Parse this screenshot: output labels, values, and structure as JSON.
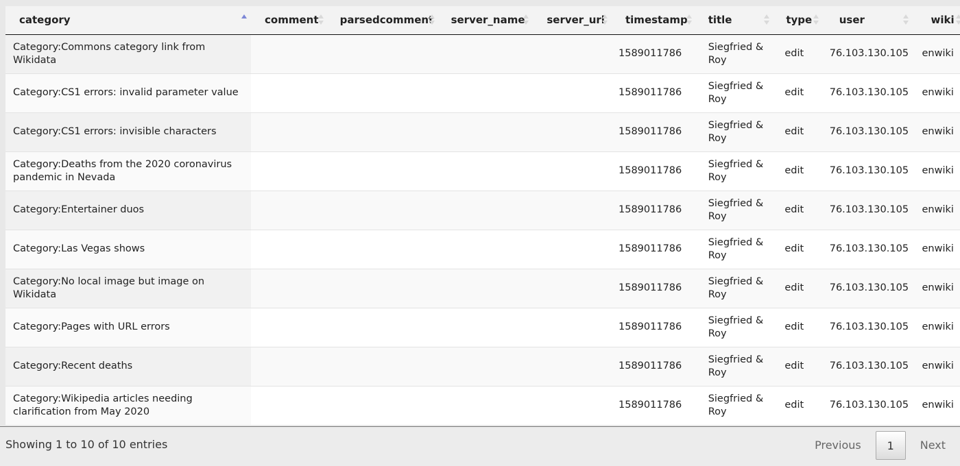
{
  "table": {
    "columns": [
      {
        "key": "category",
        "label": "category",
        "sort": "asc"
      },
      {
        "key": "comment",
        "label": "comment",
        "sort": "none"
      },
      {
        "key": "parsedcomment",
        "label": "parsedcomment",
        "sort": "none"
      },
      {
        "key": "server_name",
        "label": "server_name",
        "sort": "none"
      },
      {
        "key": "server_url",
        "label": "server_url",
        "sort": "none"
      },
      {
        "key": "timestamp",
        "label": "timestamp",
        "sort": "none"
      },
      {
        "key": "title",
        "label": "title",
        "sort": "none"
      },
      {
        "key": "type",
        "label": "type",
        "sort": "none"
      },
      {
        "key": "user",
        "label": "user",
        "sort": "none"
      },
      {
        "key": "wiki",
        "label": "wiki",
        "sort": "none"
      }
    ],
    "rows": [
      {
        "category": "Category:Commons category link from Wikidata",
        "comment": "",
        "parsedcomment": "",
        "server_name": "",
        "server_url": "",
        "timestamp": "1589011786",
        "title": "Siegfried & Roy",
        "type": "edit",
        "user": "76.103.130.105",
        "wiki": "enwiki"
      },
      {
        "category": "Category:CS1 errors: invalid parameter value",
        "comment": "",
        "parsedcomment": "",
        "server_name": "",
        "server_url": "",
        "timestamp": "1589011786",
        "title": "Siegfried & Roy",
        "type": "edit",
        "user": "76.103.130.105",
        "wiki": "enwiki"
      },
      {
        "category": "Category:CS1 errors: invisible characters",
        "comment": "",
        "parsedcomment": "",
        "server_name": "",
        "server_url": "",
        "timestamp": "1589011786",
        "title": "Siegfried & Roy",
        "type": "edit",
        "user": "76.103.130.105",
        "wiki": "enwiki"
      },
      {
        "category": "Category:Deaths from the 2020 coronavirus pandemic in Nevada",
        "comment": "",
        "parsedcomment": "",
        "server_name": "",
        "server_url": "",
        "timestamp": "1589011786",
        "title": "Siegfried & Roy",
        "type": "edit",
        "user": "76.103.130.105",
        "wiki": "enwiki"
      },
      {
        "category": "Category:Entertainer duos",
        "comment": "",
        "parsedcomment": "",
        "server_name": "",
        "server_url": "",
        "timestamp": "1589011786",
        "title": "Siegfried & Roy",
        "type": "edit",
        "user": "76.103.130.105",
        "wiki": "enwiki"
      },
      {
        "category": "Category:Las Vegas shows",
        "comment": "",
        "parsedcomment": "",
        "server_name": "",
        "server_url": "",
        "timestamp": "1589011786",
        "title": "Siegfried & Roy",
        "type": "edit",
        "user": "76.103.130.105",
        "wiki": "enwiki"
      },
      {
        "category": "Category:No local image but image on Wikidata",
        "comment": "",
        "parsedcomment": "",
        "server_name": "",
        "server_url": "",
        "timestamp": "1589011786",
        "title": "Siegfried & Roy",
        "type": "edit",
        "user": "76.103.130.105",
        "wiki": "enwiki"
      },
      {
        "category": "Category:Pages with URL errors",
        "comment": "",
        "parsedcomment": "",
        "server_name": "",
        "server_url": "",
        "timestamp": "1589011786",
        "title": "Siegfried & Roy",
        "type": "edit",
        "user": "76.103.130.105",
        "wiki": "enwiki"
      },
      {
        "category": "Category:Recent deaths",
        "comment": "",
        "parsedcomment": "",
        "server_name": "",
        "server_url": "",
        "timestamp": "1589011786",
        "title": "Siegfried & Roy",
        "type": "edit",
        "user": "76.103.130.105",
        "wiki": "enwiki"
      },
      {
        "category": "Category:Wikipedia articles needing clarification from May 2020",
        "comment": "",
        "parsedcomment": "",
        "server_name": "",
        "server_url": "",
        "timestamp": "1589011786",
        "title": "Siegfried & Roy",
        "type": "edit",
        "user": "76.103.130.105",
        "wiki": "enwiki"
      }
    ]
  },
  "footer": {
    "info": "Showing 1 to 10 of 10 entries",
    "previous_label": "Previous",
    "current_page": "1",
    "next_label": "Next"
  },
  "colors": {
    "sort_active": "#7d87d6",
    "sort_inactive": "#d9d9d9",
    "header_border": "#111111"
  },
  "icons": {
    "sort_ascending": "sort-ascending-icon",
    "sort_unsorted": "sort-unsorted-icon"
  }
}
